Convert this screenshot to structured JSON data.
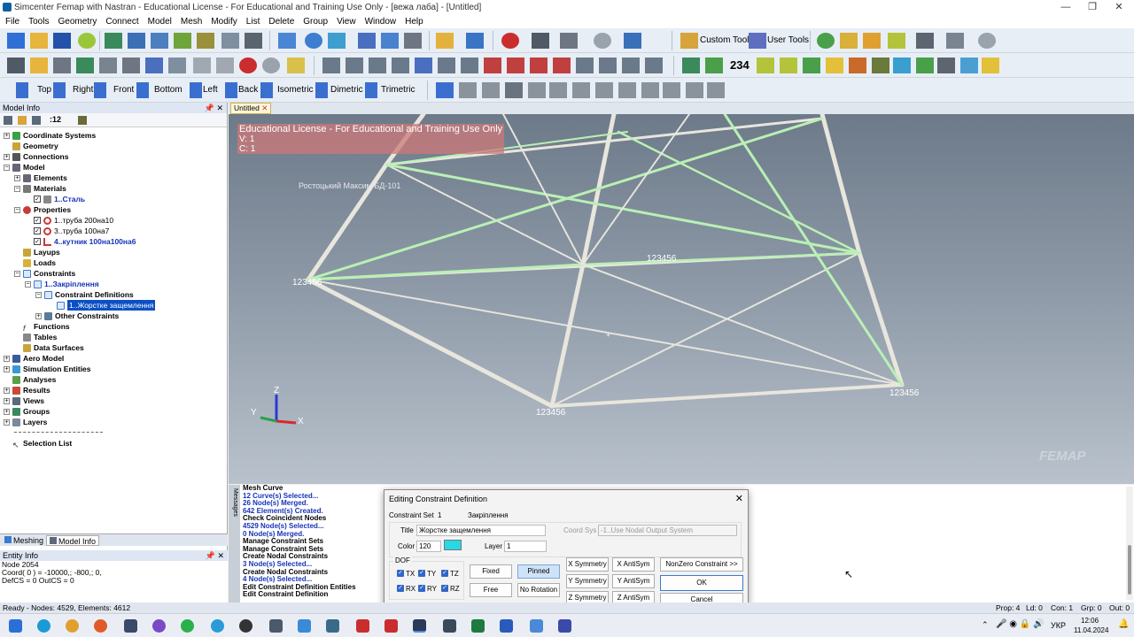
{
  "window": {
    "title": "Simcenter Femap with Nastran - Educational License - For Educational and Training Use Only - [вежа лаба] - [Untitled]",
    "controls": [
      "—",
      "❐",
      "✕"
    ]
  },
  "menu": [
    "File",
    "Tools",
    "Geometry",
    "Connect",
    "Model",
    "Mesh",
    "Modify",
    "List",
    "Delete",
    "Group",
    "View",
    "Window",
    "Help"
  ],
  "toolbar1": {
    "custom_tools": "Custom Tools",
    "user_tools": "User Tools"
  },
  "toolbar2": {
    "counter": "234"
  },
  "views_toolbar": [
    "Top",
    "Right",
    "Front",
    "Bottom",
    "Left",
    "Back",
    "Isometric",
    "Dimetric",
    "Trimetric"
  ],
  "model_info": {
    "header": "Model Info",
    "tree_toolbar_text": ":12",
    "tree": [
      {
        "label": "Coordinate Systems"
      },
      {
        "label": "Geometry"
      },
      {
        "label": "Connections"
      },
      {
        "label": "Model"
      },
      {
        "label": "Elements"
      },
      {
        "label": "Materials"
      },
      {
        "label": "1..Сталь"
      },
      {
        "label": "Properties"
      },
      {
        "label": "1..труба 200на10"
      },
      {
        "label": "3..труба 100на7"
      },
      {
        "label": "4..кутник 100на100на6"
      },
      {
        "label": "Layups"
      },
      {
        "label": "Loads"
      },
      {
        "label": "Constraints"
      },
      {
        "label": "1..Закріплення"
      },
      {
        "label": "Constraint Definitions"
      },
      {
        "label": "1..Жорстке защемлення"
      },
      {
        "label": "Other Constraints"
      },
      {
        "label": "Functions"
      },
      {
        "label": "Tables"
      },
      {
        "label": "Data Surfaces"
      },
      {
        "label": "Aero Model"
      },
      {
        "label": "Simulation Entities"
      },
      {
        "label": "Analyses"
      },
      {
        "label": "Results"
      },
      {
        "label": "Views"
      },
      {
        "label": "Groups"
      },
      {
        "label": "Layers"
      },
      {
        "label": "Selection List"
      }
    ]
  },
  "panel_tabs": [
    "Meshing",
    "Model Info"
  ],
  "entity_info": {
    "header": "Entity Info",
    "lines": [
      "Node 2054",
      "Coord( 0 ) = -10000,; -800,; 0,",
      "DefCS = 0  OutCS = 0"
    ]
  },
  "view_tab": "Untitled",
  "viewport": {
    "license_lines": [
      "Educational License - For Educational and Training Use Only",
      "V: 1",
      "C: 1"
    ],
    "name_label": "Ростоцький Максим БД-101",
    "node_labels": [
      "123456",
      "123456",
      "123456",
      "123456"
    ],
    "axis": {
      "z": "Z",
      "y": "Y",
      "x": "X"
    },
    "watermark": "FEMAP"
  },
  "messages_side_label": "Messages",
  "messages": [
    {
      "text": "Mesh Curve",
      "blue": false
    },
    {
      "text": "12 Curve(s) Selected...",
      "blue": true
    },
    {
      "text": "26 Node(s) Merged.",
      "blue": true
    },
    {
      "text": "642 Element(s) Created.",
      "blue": true
    },
    {
      "text": "Check Coincident Nodes",
      "blue": false
    },
    {
      "text": "4529 Node(s) Selected...",
      "blue": true
    },
    {
      "text": "0 Node(s) Merged.",
      "blue": true
    },
    {
      "text": "Manage Constraint Sets",
      "blue": false
    },
    {
      "text": "Manage Constraint Sets",
      "blue": false
    },
    {
      "text": "Create Nodal Constraints",
      "blue": false
    },
    {
      "text": "3 Node(s) Selected...",
      "blue": true
    },
    {
      "text": "Create Nodal Constraints",
      "blue": false
    },
    {
      "text": "4 Node(s) Selected...",
      "blue": true
    },
    {
      "text": "Edit Constraint Definition Entities",
      "blue": false
    },
    {
      "text": "Edit Constraint Definition",
      "blue": false
    }
  ],
  "dialog": {
    "title": "Editing Constraint Definition",
    "close": "✕",
    "constraint_set_label": "Constraint Set",
    "constraint_set_id": "1",
    "constraint_set_name": "Закріплення",
    "title_label": "Title",
    "title_value": "Жорстке защемлення",
    "coord_sys_label": "Coord Sys",
    "coord_sys_value": "-1..Use Nodal Output System",
    "color_label": "Color",
    "color_value": "120",
    "color_swatch": "#27d9e6",
    "layer_label": "Layer",
    "layer_value": "1",
    "dof_label": "DOF",
    "dof": [
      "TX",
      "TY",
      "TZ",
      "RX",
      "RY",
      "RZ"
    ],
    "buttons": {
      "fixed": "Fixed",
      "pinned": "Pinned",
      "free": "Free",
      "no_rotation": "No Rotation",
      "x_sym": "X Symmetry",
      "x_anti": "X AntiSym",
      "y_sym": "Y Symmetry",
      "y_anti": "Y AntiSym",
      "z_sym": "Z Symmetry",
      "z_anti": "Z AntiSym",
      "nonzero": "NonZero Constraint >>",
      "ok": "OK",
      "cancel": "Cancel"
    }
  },
  "statusbar": {
    "left": "Ready - Nodes: 4529,  Elements: 4612",
    "prop": "Prop: 4",
    "ld": "Ld: 0",
    "con": "Con: 1",
    "grp": "Grp: 0",
    "out": "Out: 0"
  },
  "taskbar": {
    "lang": "УКР",
    "time": "12:06",
    "date": "11.04.2024"
  }
}
